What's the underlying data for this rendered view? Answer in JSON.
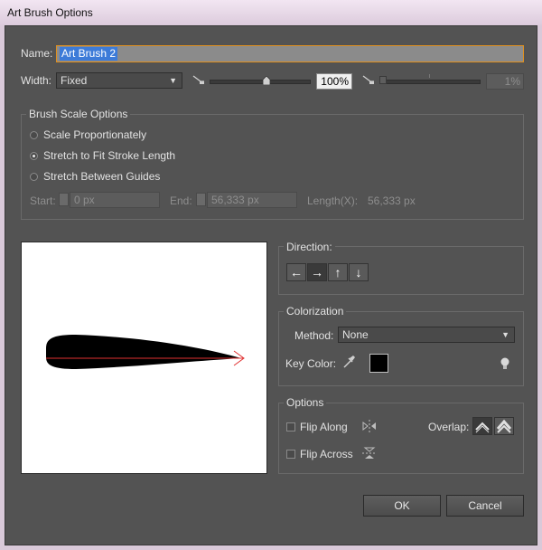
{
  "window": {
    "title": "Art Brush Options"
  },
  "name": {
    "label": "Name:",
    "value": "Art Brush 2"
  },
  "width": {
    "label": "Width:",
    "mode": "Fixed",
    "percent1": "100%",
    "percent2": "1%",
    "level1": 0.57,
    "level2": 0.0
  },
  "scale_options": {
    "title": "Brush Scale Options",
    "radios": [
      {
        "label": "Scale Proportionately",
        "selected": false
      },
      {
        "label": "Stretch to Fit Stroke Length",
        "selected": true
      },
      {
        "label": "Stretch Between Guides",
        "selected": false
      }
    ],
    "start_label": "Start:",
    "start_value": "0 px",
    "end_label": "End:",
    "end_value": "56,333 px",
    "length_label": "Length(X):",
    "length_value": "56,333 px"
  },
  "direction": {
    "title": "Direction:",
    "buttons": [
      {
        "icon": "arrow-left-icon",
        "glyph": "←",
        "selected": false
      },
      {
        "icon": "arrow-right-icon",
        "glyph": "→",
        "selected": true
      },
      {
        "icon": "arrow-up-icon",
        "glyph": "↑",
        "selected": false
      },
      {
        "icon": "arrow-down-icon",
        "glyph": "↓",
        "selected": false
      }
    ]
  },
  "colorization": {
    "title": "Colorization",
    "method_label": "Method:",
    "method_value": "None",
    "key_color_label": "Key Color:",
    "key_color": "#000000"
  },
  "options": {
    "title": "Options",
    "flip_along": "Flip Along",
    "flip_across": "Flip Across",
    "overlap_label": "Overlap:"
  },
  "buttons": {
    "ok": "OK",
    "cancel": "Cancel"
  },
  "colors": {
    "background": "#535353",
    "field": "#3e3e3e",
    "preview_stroke": "#000000",
    "preview_path": "#e03030",
    "name_highlight": "#3d7bd8"
  }
}
